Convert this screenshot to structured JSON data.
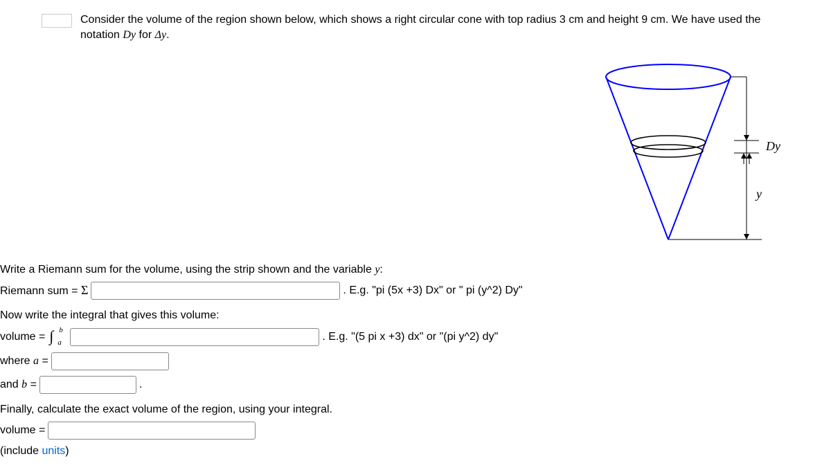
{
  "intro": {
    "prefix": "Consider the volume of the region shown below, which shows a right circular cone with top radius 3 cm and height 9 cm. We have used the notation ",
    "notation1": "Dy",
    "middle": " for ",
    "notation2": "Δy",
    "suffix": "."
  },
  "figure": {
    "dy_label": "Dy",
    "y_label": "y"
  },
  "section1": {
    "prompt": "Write a Riemann sum for the volume, using the strip shown and the variable ",
    "var": "y",
    "suffix": ":",
    "label_prefix": "Riemann sum = ",
    "sigma": "Σ",
    "hint": ". E.g. \"pi (5x +3) Dx\" or \" pi (y^2) Dy\""
  },
  "section2": {
    "prompt": "Now write the integral that gives this volume:",
    "label": "volume = ",
    "int_upper": "b",
    "int_lower": "a",
    "hint": ". E.g. \"(5 pi x +3) dx\" or \"(pi y^2) dy\"",
    "where_a_prefix": "where ",
    "where_a_var": "a",
    "where_a_eq": " =",
    "and_b_prefix": "and ",
    "and_b_var": "b",
    "and_b_eq": " =",
    "b_suffix": "."
  },
  "section3": {
    "prompt": "Finally, calculate the exact volume of the region, using your integral.",
    "label": "volume =",
    "include_prefix": "(include ",
    "units_link": "units",
    "include_suffix": ")"
  }
}
